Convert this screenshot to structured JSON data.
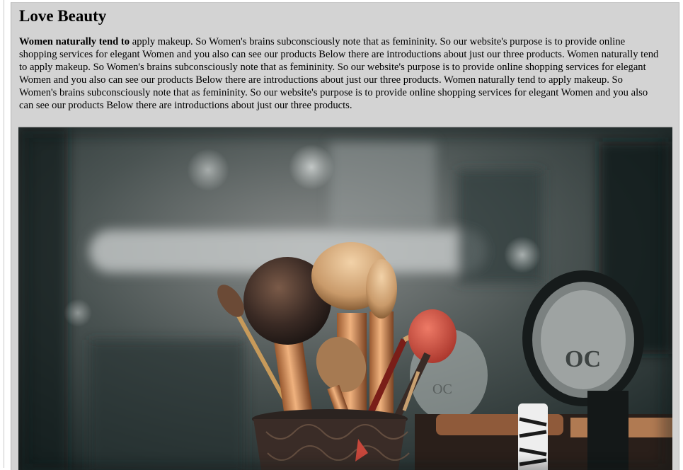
{
  "page": {
    "title": "Love Beauty",
    "intro_bold": "Women naturally tend to",
    "intro_rest": " apply makeup. So Women's brains subconsciously note that as femininity. So our website's purpose is to provide online shopping services for elegant Women and you also can see our products Below there are introductions about just our three products. Women naturally tend to apply makeup. So Women's brains subconsciously note that as femininity. So our website's purpose is to provide online shopping services for elegant Women and you also can see our products Below there are introductions about just our three products. Women naturally tend to apply makeup. So Women's brains subconsciously note that as femininity. So our website's purpose is to provide online shopping services for elegant Women and you also can see our products Below there are introductions about just our three products."
  },
  "hero_image": {
    "subject": "makeup brushes in a holder with compact powder",
    "compact_label": "OC"
  },
  "colors": {
    "panel_background": "#d3d3d3",
    "text": "#000000",
    "brush_copper": "#d98a55",
    "sponge_red": "#c7473b"
  }
}
